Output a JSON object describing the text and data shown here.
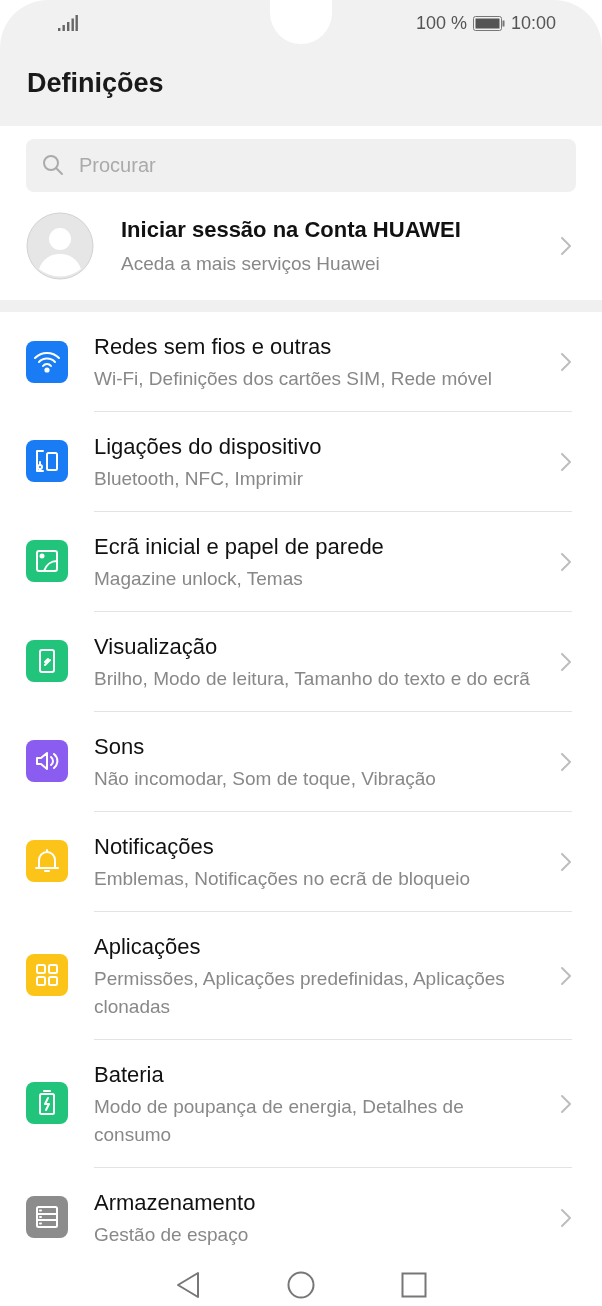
{
  "status_bar": {
    "battery": "100 %",
    "time": "10:00"
  },
  "header": {
    "title": "Definições"
  },
  "search": {
    "placeholder": "Procurar"
  },
  "account": {
    "title": "Iniciar sessão na Conta HUAWEI",
    "subtitle": "Aceda a mais serviços Huawei"
  },
  "items": [
    {
      "kind": "wifi",
      "color": "#1a7cf5",
      "title": "Redes sem fios e outras",
      "subtitle": "Wi-Fi, Definições dos cartões SIM, Rede móvel"
    },
    {
      "kind": "devices",
      "color": "#1a7cf5",
      "title": "Ligações do dispositivo",
      "subtitle": "Bluetooth, NFC, Imprimir"
    },
    {
      "kind": "wallpaper",
      "color": "#21c47a",
      "title": "Ecrã inicial e papel de parede",
      "subtitle": "Magazine unlock, Temas"
    },
    {
      "kind": "display",
      "color": "#21c47a",
      "title": "Visualização",
      "subtitle": "Brilho, Modo de leitura, Tamanho do texto e do ecrã"
    },
    {
      "kind": "sound",
      "color": "#8a5cf0",
      "title": "Sons",
      "subtitle": "Não incomodar, Som de toque, Vibração"
    },
    {
      "kind": "bell",
      "color": "#fcc419",
      "title": "Notificações",
      "subtitle": "Emblemas, Notificações no ecrã de bloqueio"
    },
    {
      "kind": "apps",
      "color": "#fcc419",
      "title": "Aplicações",
      "subtitle": "Permissões, Aplicações predefinidas, Aplicações clonadas"
    },
    {
      "kind": "battery",
      "color": "#21c47a",
      "title": "Bateria",
      "subtitle": "Modo de poupança de energia, Detalhes de consumo"
    },
    {
      "kind": "storage",
      "color": "#8c8c8c",
      "title": "Armazenamento",
      "subtitle": "Gestão de espaço"
    }
  ]
}
